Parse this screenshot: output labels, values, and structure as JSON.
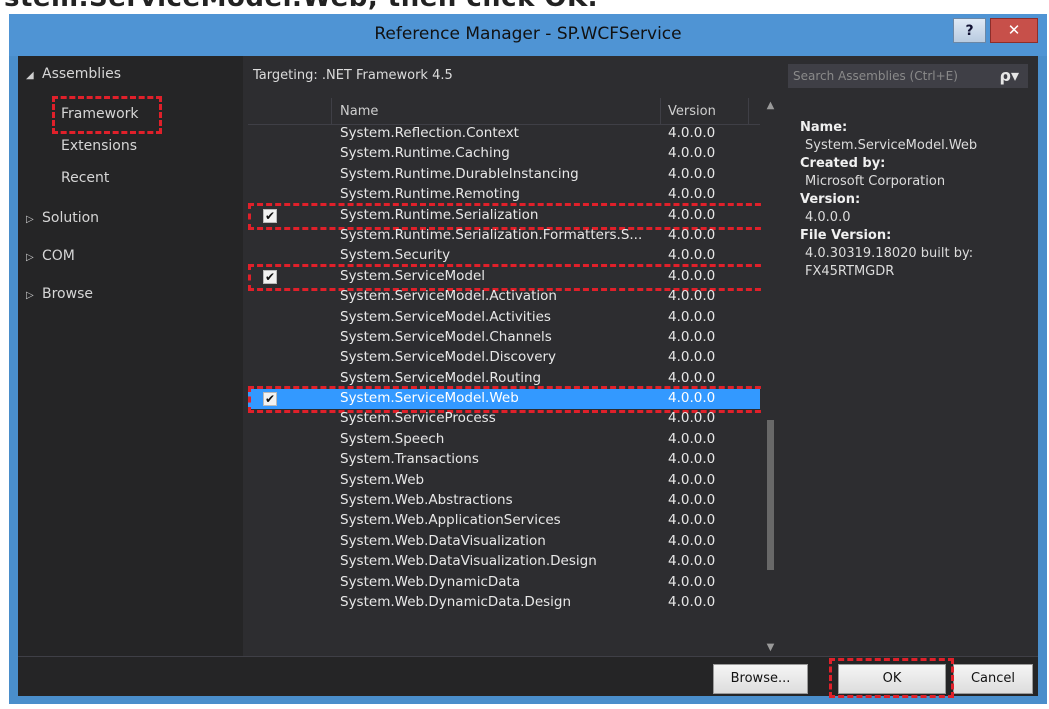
{
  "caption": {
    "text": "stem.ServiceModel.Web, then click OK."
  },
  "window": {
    "title": "Reference Manager - SP.WCFService",
    "help_label": "?",
    "close_label": "✕"
  },
  "sidebar": {
    "items": [
      {
        "label": "Assemblies",
        "arrow": "◢"
      },
      {
        "label": "Framework"
      },
      {
        "label": "Extensions"
      },
      {
        "label": "Recent"
      },
      {
        "label": "Solution",
        "arrow": "▷"
      },
      {
        "label": "COM",
        "arrow": "▷"
      },
      {
        "label": "Browse",
        "arrow": "▷"
      }
    ]
  },
  "toolbar": {
    "targeting": "Targeting: .NET Framework 4.5",
    "search_placeholder": "Search Assemblies (Ctrl+E)",
    "search_icon": "ρ▾"
  },
  "grid": {
    "columns": {
      "name": "Name",
      "version": "Version"
    },
    "rows": [
      {
        "name": "System.Reflection.Context",
        "version": "4.0.0.0",
        "checked": false,
        "selected": false
      },
      {
        "name": "System.Runtime.Caching",
        "version": "4.0.0.0",
        "checked": false,
        "selected": false
      },
      {
        "name": "System.Runtime.DurableInstancing",
        "version": "4.0.0.0",
        "checked": false,
        "selected": false
      },
      {
        "name": "System.Runtime.Remoting",
        "version": "4.0.0.0",
        "checked": false,
        "selected": false
      },
      {
        "name": "System.Runtime.Serialization",
        "version": "4.0.0.0",
        "checked": true,
        "selected": false
      },
      {
        "name": "System.Runtime.Serialization.Formatters.S...",
        "version": "4.0.0.0",
        "checked": false,
        "selected": false
      },
      {
        "name": "System.Security",
        "version": "4.0.0.0",
        "checked": false,
        "selected": false
      },
      {
        "name": "System.ServiceModel",
        "version": "4.0.0.0",
        "checked": true,
        "selected": false
      },
      {
        "name": "System.ServiceModel.Activation",
        "version": "4.0.0.0",
        "checked": false,
        "selected": false
      },
      {
        "name": "System.ServiceModel.Activities",
        "version": "4.0.0.0",
        "checked": false,
        "selected": false
      },
      {
        "name": "System.ServiceModel.Channels",
        "version": "4.0.0.0",
        "checked": false,
        "selected": false
      },
      {
        "name": "System.ServiceModel.Discovery",
        "version": "4.0.0.0",
        "checked": false,
        "selected": false
      },
      {
        "name": "System.ServiceModel.Routing",
        "version": "4.0.0.0",
        "checked": false,
        "selected": false
      },
      {
        "name": "System.ServiceModel.Web",
        "version": "4.0.0.0",
        "checked": true,
        "selected": true
      },
      {
        "name": "System.ServiceProcess",
        "version": "4.0.0.0",
        "checked": false,
        "selected": false
      },
      {
        "name": "System.Speech",
        "version": "4.0.0.0",
        "checked": false,
        "selected": false
      },
      {
        "name": "System.Transactions",
        "version": "4.0.0.0",
        "checked": false,
        "selected": false
      },
      {
        "name": "System.Web",
        "version": "4.0.0.0",
        "checked": false,
        "selected": false
      },
      {
        "name": "System.Web.Abstractions",
        "version": "4.0.0.0",
        "checked": false,
        "selected": false
      },
      {
        "name": "System.Web.ApplicationServices",
        "version": "4.0.0.0",
        "checked": false,
        "selected": false
      },
      {
        "name": "System.Web.DataVisualization",
        "version": "4.0.0.0",
        "checked": false,
        "selected": false
      },
      {
        "name": "System.Web.DataVisualization.Design",
        "version": "4.0.0.0",
        "checked": false,
        "selected": false
      },
      {
        "name": "System.Web.DynamicData",
        "version": "4.0.0.0",
        "checked": false,
        "selected": false
      },
      {
        "name": "System.Web.DynamicData.Design",
        "version": "4.0.0.0",
        "checked": false,
        "selected": false
      }
    ]
  },
  "details": {
    "name_label": "Name:",
    "name_value": "System.ServiceModel.Web",
    "created_label": "Created by:",
    "created_value": "Microsoft Corporation",
    "version_label": "Version:",
    "version_value": "4.0.0.0",
    "file_version_label": "File Version:",
    "file_version_value1": "4.0.30319.18020 built by:",
    "file_version_value2": "FX45RTMGDR"
  },
  "footer": {
    "browse_label": "Browse...",
    "ok_label": "OK",
    "cancel_label": "Cancel"
  },
  "colors": {
    "titlebar": "#4f94d4",
    "selection": "#3399ff",
    "highlight_dash": "#e0202a",
    "panel_bg": "#2d2d30"
  }
}
